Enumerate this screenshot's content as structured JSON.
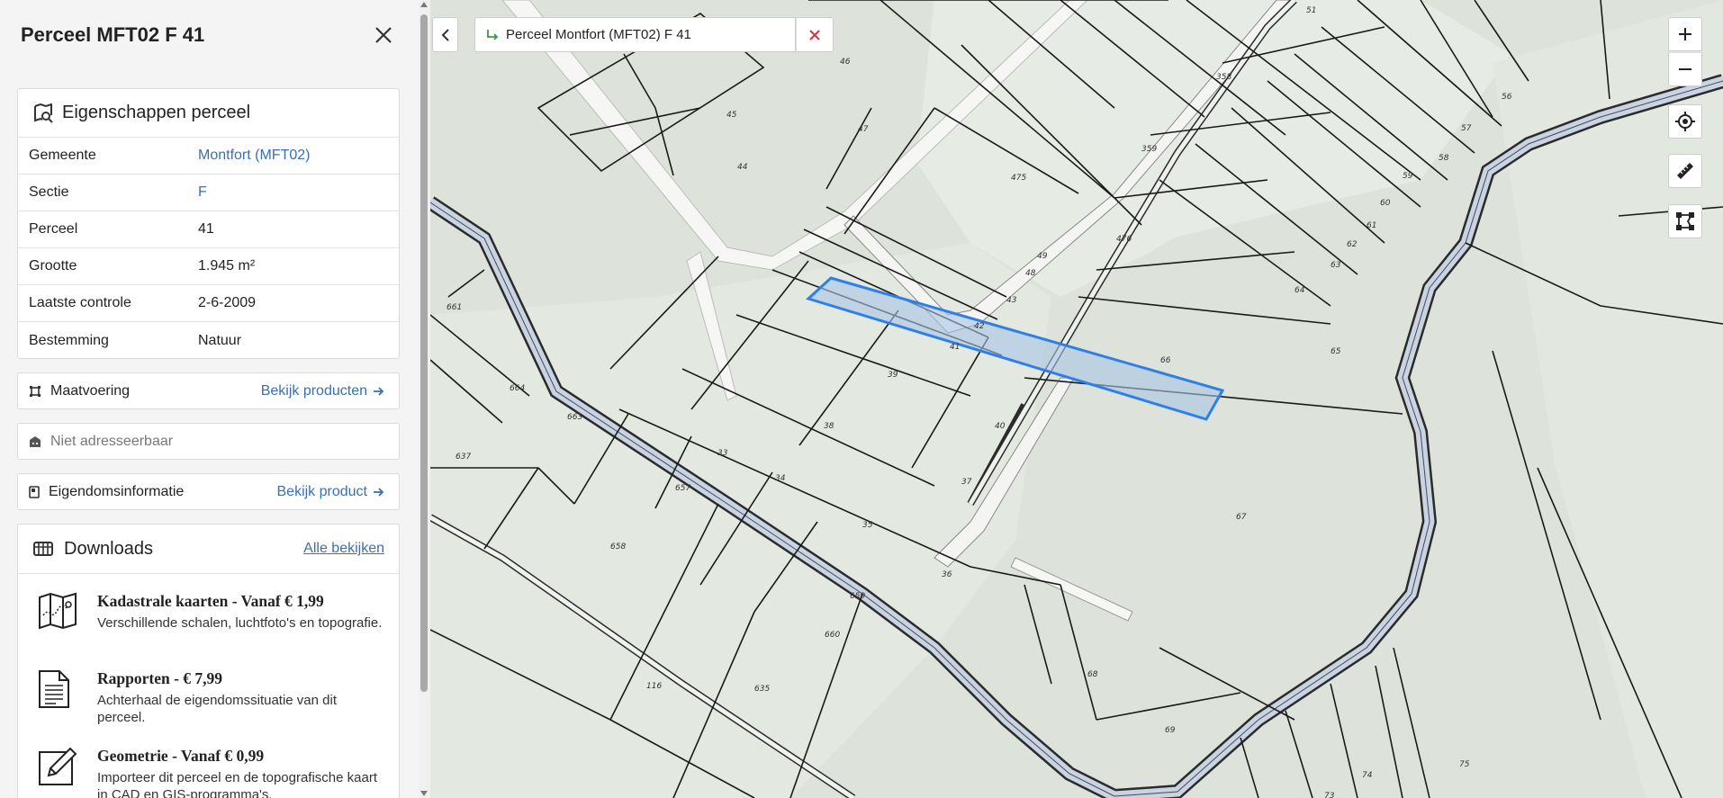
{
  "sidebar": {
    "title": "Perceel MFT02 F 41",
    "properties": {
      "heading": "Eigenschappen perceel",
      "rows": [
        {
          "key": "Gemeente",
          "value": "Montfort (MFT02)"
        },
        {
          "key": "Sectie",
          "value": "F"
        },
        {
          "key": "Perceel",
          "value": "41"
        },
        {
          "key": "Grootte",
          "value": "1.945 m²"
        },
        {
          "key": "Laatste controle",
          "value": "2-6-2009"
        },
        {
          "key": "Bestemming",
          "value": "Natuur"
        }
      ]
    },
    "maatvoering": {
      "label": "Maatvoering",
      "action": "Bekijk producten"
    },
    "address": {
      "label": "Niet adresseerbaar"
    },
    "eigendom": {
      "label": "Eigendomsinformatie",
      "action": "Bekijk product"
    },
    "downloads": {
      "heading": "Downloads",
      "view_all": "Alle bekijken",
      "items": [
        {
          "title": "Kadastrale kaarten - Vanaf € 1,99",
          "desc": "Verschillende schalen, luchtfoto's en topografie.",
          "icon": "map-icon"
        },
        {
          "title": "Rapporten - € 7,99",
          "desc": "Achterhaal de eigendomssituatie van dit perceel.",
          "icon": "document-icon"
        },
        {
          "title": "Geometrie - Vanaf € 0,99",
          "desc": "Importeer dit perceel en de topografische kaart in CAD en GIS-programma's.",
          "icon": "pen-icon"
        }
      ]
    }
  },
  "map": {
    "breadcrumb": "Perceel Montfort (MFT02) F 41",
    "highlight_color": "#2f7fe8",
    "parcel_labels": [
      "51",
      "358",
      "56",
      "57",
      "58",
      "59",
      "60",
      "61",
      "62",
      "63",
      "64",
      "65",
      "66",
      "359",
      "475",
      "476",
      "49",
      "48",
      "43",
      "42",
      "41",
      "39",
      "40",
      "38",
      "37",
      "33",
      "34",
      "35",
      "36",
      "45",
      "46",
      "47",
      "44",
      "661",
      "664",
      "637",
      "663",
      "658",
      "657",
      "659",
      "660",
      "635",
      "116",
      "67",
      "68",
      "69",
      "74",
      "73",
      "75"
    ]
  }
}
